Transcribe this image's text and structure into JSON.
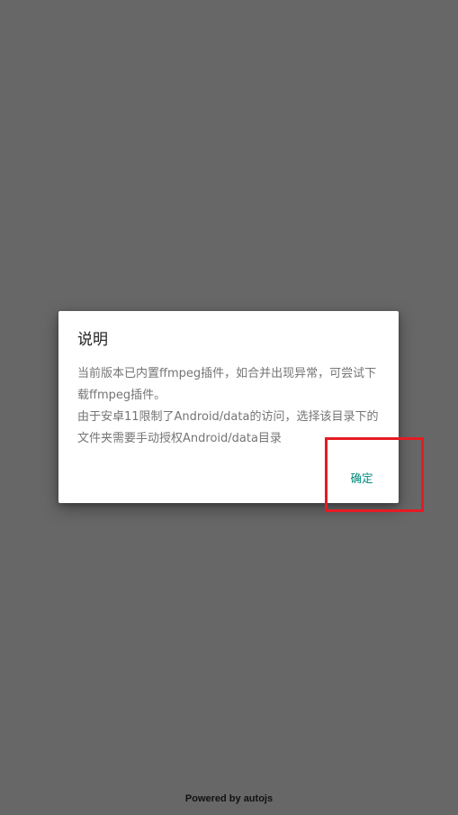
{
  "dialog": {
    "title": "说明",
    "message_line1": "当前版本已内置ffmpeg插件，如合并出现异常，可尝试下载ffmpeg插件。",
    "message_line2": "由于安卓11限制了Android/data的访问，选择该目录下的文件夹需要手动授权Android/data目录",
    "confirm_label": "确定"
  },
  "footer": {
    "text": "Powered by autojs"
  },
  "colors": {
    "overlay": "#676767",
    "accent": "#00897b",
    "highlight": "#e51b24"
  }
}
